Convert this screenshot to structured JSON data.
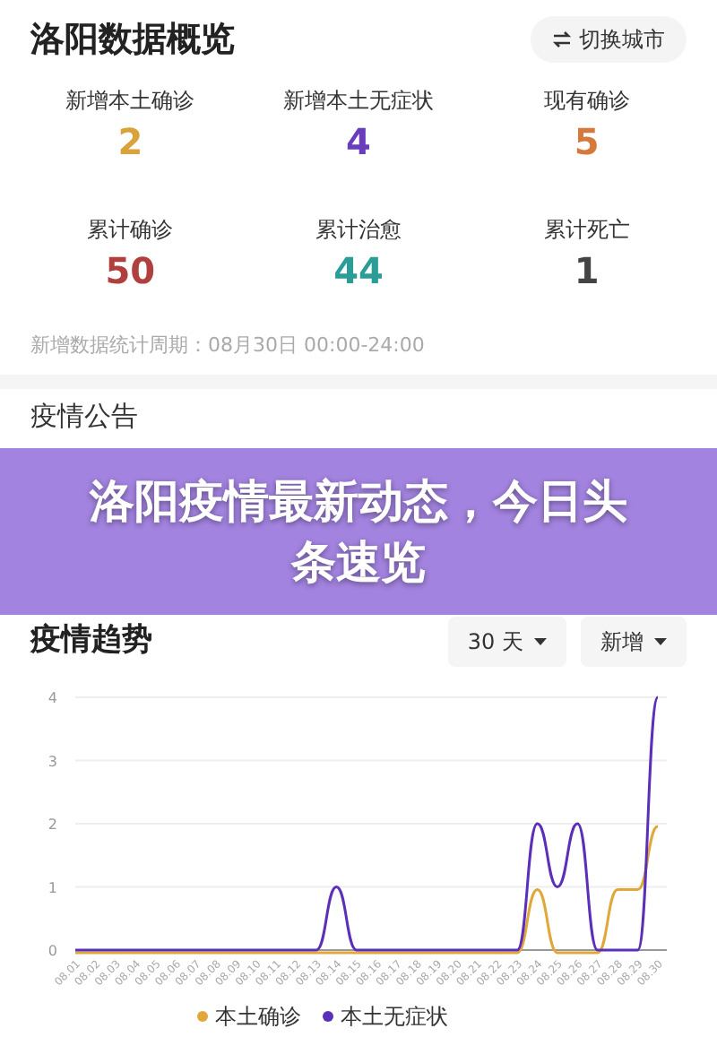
{
  "overview": {
    "title": "洛阳数据概览",
    "switch_button": "切换城市",
    "stats": [
      {
        "label": "新增本土确诊",
        "value": "2",
        "color": "#d9a23a"
      },
      {
        "label": "新增本土无症状",
        "value": "4",
        "color": "#6a3dbf"
      },
      {
        "label": "现有确诊",
        "value": "5",
        "color": "#d57a3c"
      },
      {
        "label": "累计确诊",
        "value": "50",
        "color": "#b03f3f"
      },
      {
        "label": "累计治愈",
        "value": "44",
        "color": "#2a9d97"
      },
      {
        "label": "累计死亡",
        "value": "1",
        "color": "#444444"
      }
    ],
    "period": "新增数据统计周期：08月30日 00:00-24:00"
  },
  "notice": {
    "title": "疫情公告"
  },
  "banner": {
    "title": "洛阳疫情最新动态，今日头条速览"
  },
  "trend": {
    "title": "疫情趋势",
    "filters": [
      "30 天",
      "新增"
    ],
    "chart_data": {
      "type": "line",
      "categories": [
        "08.01",
        "08.02",
        "08.03",
        "08.04",
        "08.05",
        "08.06",
        "08.07",
        "08.08",
        "08.09",
        "08.10",
        "08.11",
        "08.12",
        "08.13",
        "08.14",
        "08.15",
        "08.16",
        "08.17",
        "08.18",
        "08.19",
        "08.20",
        "08.21",
        "08.22",
        "08.23",
        "08.24",
        "08.25",
        "08.26",
        "08.27",
        "08.28",
        "08.29",
        "08.30"
      ],
      "ylim": [
        0,
        4
      ],
      "yticks": [
        {
          "value": 0,
          "label": "0"
        },
        {
          "value": 1,
          "label": "1"
        },
        {
          "value": 2,
          "label": "2"
        },
        {
          "value": 3,
          "label": "3"
        },
        {
          "value": 4,
          "label": "4"
        }
      ],
      "grid": true,
      "legend": true,
      "series": [
        {
          "name": "本土确诊",
          "color": "#e0a83a",
          "values": [
            0,
            0,
            0,
            0,
            0,
            0,
            0,
            0,
            0,
            0,
            0,
            0,
            0,
            0,
            0,
            0,
            0,
            0,
            0,
            0,
            0,
            0,
            0,
            1,
            0,
            0,
            0,
            1,
            1,
            2
          ]
        },
        {
          "name": "本土无症状",
          "color": "#5b2fb8",
          "values": [
            0,
            0,
            0,
            0,
            0,
            0,
            0,
            0,
            0,
            0,
            0,
            0,
            0,
            1,
            0,
            0,
            0,
            0,
            0,
            0,
            0,
            0,
            0,
            2,
            1,
            2,
            0,
            0,
            0,
            4
          ]
        }
      ]
    }
  }
}
